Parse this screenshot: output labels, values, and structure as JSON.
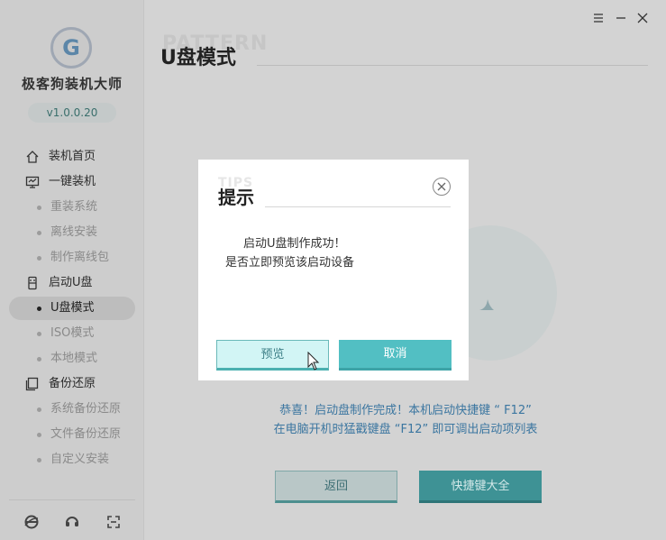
{
  "app": {
    "name": "极客狗装机大师",
    "version": "v1.0.0.20",
    "logo_letter": "G"
  },
  "sidebar": {
    "items": [
      {
        "label": "装机首页",
        "icon": "home-icon"
      },
      {
        "label": "一键装机",
        "icon": "monitor-icon"
      },
      {
        "label": "重装系统",
        "sub": true
      },
      {
        "label": "离线安装",
        "sub": true
      },
      {
        "label": "制作离线包",
        "sub": true
      },
      {
        "label": "启动U盘",
        "icon": "usb-icon"
      },
      {
        "label": "U盘模式",
        "sub": true,
        "active": true
      },
      {
        "label": "ISO模式",
        "sub": true
      },
      {
        "label": "本地模式",
        "sub": true
      },
      {
        "label": "备份还原",
        "icon": "backup-icon"
      },
      {
        "label": "系统备份还原",
        "sub": true
      },
      {
        "label": "文件备份还原",
        "sub": true
      },
      {
        "label": "自定义安装",
        "sub": true
      }
    ],
    "bottom_icons": [
      "browser-icon",
      "support-chat-icon",
      "fullscreen-icon"
    ]
  },
  "window": {
    "controls": [
      "menu-icon",
      "minimize-icon",
      "close-icon"
    ]
  },
  "main": {
    "title": "U盘模式",
    "title_watermark": "PATTERN",
    "message_line1": "恭喜！启动盘制作完成！本机启动快捷键 “ F12”",
    "message_line2": "在电脑开机时猛戳键盘 “F12” 即可调出启动项列表",
    "back_label": "返回",
    "hotkeys_label": "快捷键大全"
  },
  "dialog": {
    "title": "提示",
    "title_watermark": "TIPS",
    "message_line1": "启动U盘制作成功！",
    "message_line2": "是否立即预览该启动设备",
    "preview_label": "预览",
    "cancel_label": "取消"
  },
  "colors": {
    "accent": "#52bfc3",
    "accent_dark": "#3e9295",
    "message_text": "#3b76a0",
    "overlay": "#d3d3d3"
  }
}
